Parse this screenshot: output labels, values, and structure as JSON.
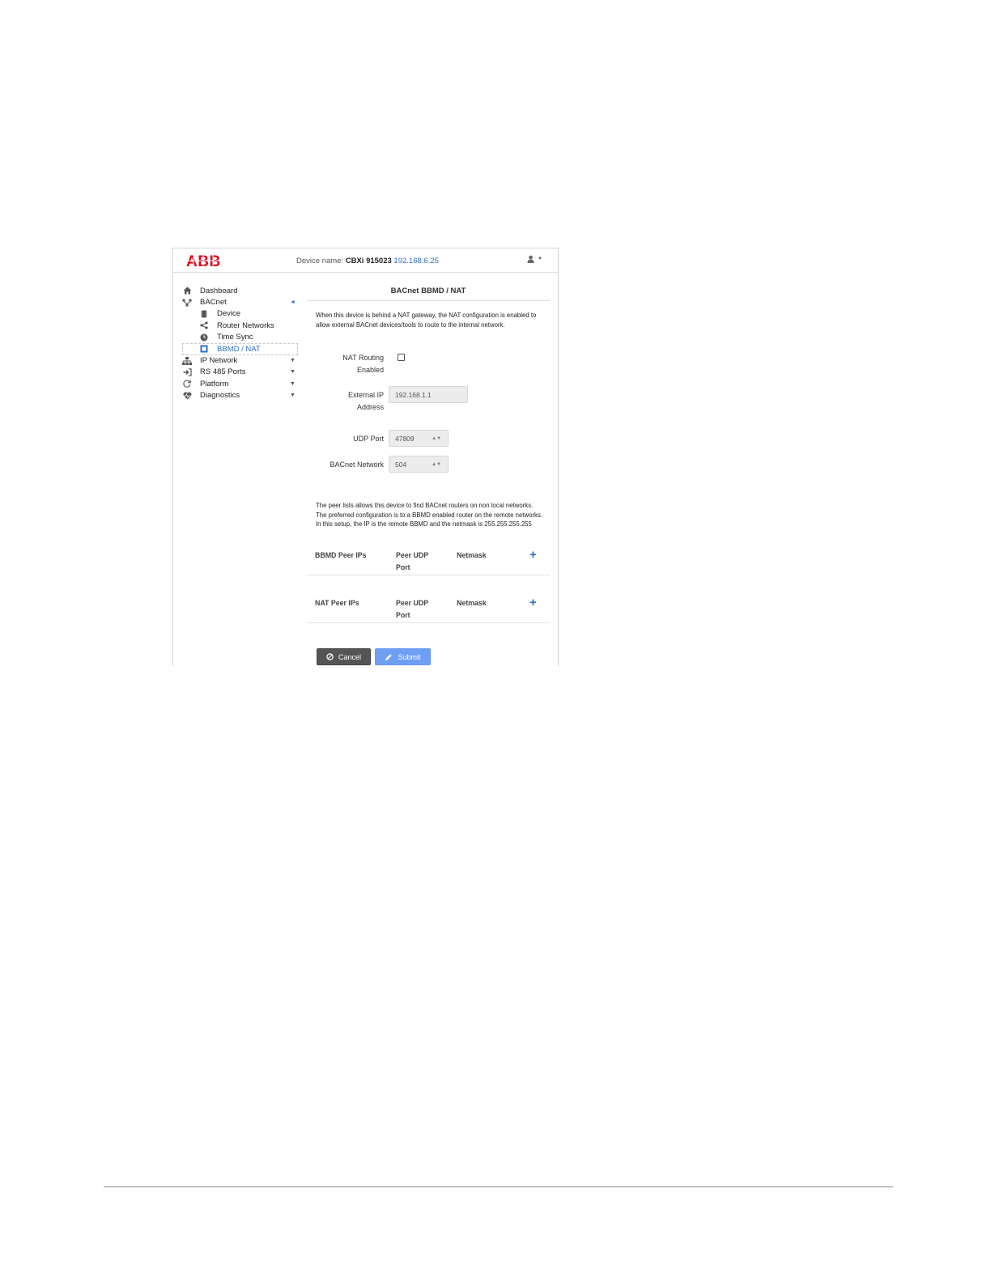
{
  "header": {
    "logo_text": "ABB",
    "device_prefix": "Device name:",
    "device_name": "CBXi 915023",
    "device_ip": "192.168.6.25",
    "user_icon": "user-icon",
    "colors": {
      "brand": "#e2001a",
      "link": "#2f6fc9"
    }
  },
  "sidebar": {
    "items": [
      {
        "label": "Dashboard",
        "icon": "home-icon"
      },
      {
        "label": "BACnet",
        "icon": "network-tree-icon",
        "arrow": "◄"
      },
      {
        "label": "Device",
        "icon": "device-icon",
        "sub": true
      },
      {
        "label": "Router Networks",
        "icon": "share-icon",
        "sub": true
      },
      {
        "label": "Time Sync",
        "icon": "clock-icon",
        "sub": true
      },
      {
        "label": "BBMD / NAT",
        "icon": "bbmd-icon",
        "sub": true,
        "active": true
      },
      {
        "label": "IP Network",
        "icon": "sitemap-icon",
        "arrow": "▼"
      },
      {
        "label": "RS 485 Ports",
        "icon": "sign-in-icon",
        "arrow": "▼"
      },
      {
        "label": "Platform",
        "icon": "refresh-icon",
        "arrow": "▼"
      },
      {
        "label": "Diagnostics",
        "icon": "heartbeat-icon",
        "arrow": "▼"
      }
    ]
  },
  "main": {
    "title": "BACnet BBMD / NAT",
    "intro": "When this device is behind a NAT gateway, the NAT configuration is enabled to allow external BACnet devices/tools to route to the internal network.",
    "form": {
      "nat_routing_label_1": "NAT Routing",
      "nat_routing_label_2": "Enabled",
      "nat_routing_checked": false,
      "external_ip_label_1": "External IP",
      "external_ip_label_2": "Address",
      "external_ip_value": "192.168.1.1",
      "udp_port_label": "UDP Port",
      "udp_port_value": "47809",
      "bacnet_network_label": "BACnet Network",
      "bacnet_network_value": "504"
    },
    "peer_text": "The peer lists allows this device to find BACnet routers on non local networks. The preferred configuration is to a BBMD enabled router on the remote networks. In this setup, the IP is the remote BBMD and the netmask is 255.255.255.255",
    "bbmd_table": {
      "col1": "BBMD Peer IPs",
      "col2_line1": "Peer UDP",
      "col2_line2": "Port",
      "col3": "Netmask",
      "add": "+"
    },
    "nat_table": {
      "col1": "NAT Peer IPs",
      "col2_line1": "Peer UDP",
      "col2_line2": "Port",
      "col3": "Netmask",
      "add": "+"
    },
    "buttons": {
      "cancel": "Cancel",
      "submit": "Submit"
    }
  }
}
